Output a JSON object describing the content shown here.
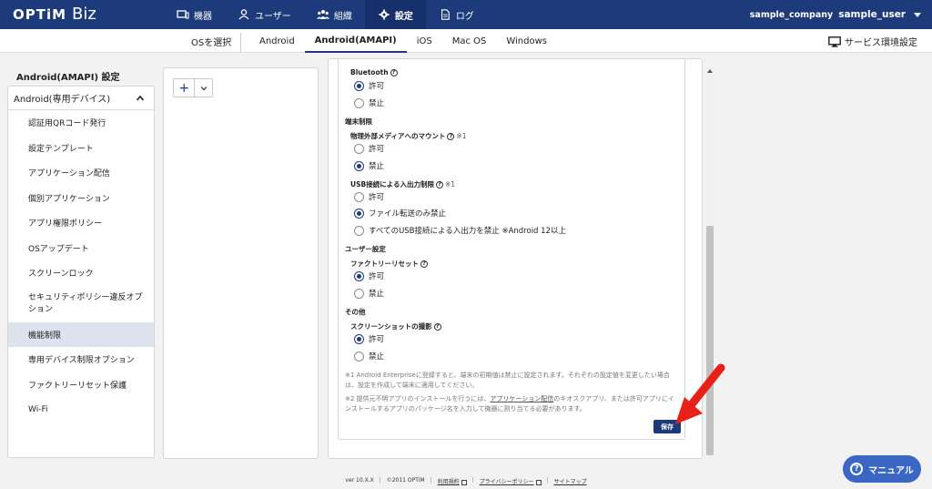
{
  "header": {
    "logo_main": "OPTiM",
    "logo_sub": "Biz",
    "nav": [
      {
        "label": "機器",
        "icon": "device-icon"
      },
      {
        "label": "ユーザー",
        "icon": "user-icon"
      },
      {
        "label": "組織",
        "icon": "group-icon"
      },
      {
        "label": "設定",
        "icon": "gear-icon"
      },
      {
        "label": "ログ",
        "icon": "log-icon"
      }
    ],
    "active_nav": "設定",
    "company": "sample_company",
    "username": "sample_user"
  },
  "subnav": {
    "os_select": "OSを選択",
    "tabs": [
      "Android",
      "Android(AMAPI)",
      "iOS",
      "Mac OS",
      "Windows"
    ],
    "active_tab": "Android(AMAPI)",
    "service_env": "サービス環境設定"
  },
  "sidebar": {
    "title": "Android(AMAPI) 設定",
    "group": "Android(専用デバイス)",
    "items": [
      "認証用QRコード発行",
      "設定テンプレート",
      "アプリケーション配信",
      "個別アプリケーション",
      "アプリ権限ポリシー",
      "OSアップデート",
      "スクリーンロック",
      "セキュリティポリシー違反オプション",
      "機能制限",
      "専用デバイス制限オプション",
      "ファクトリーリセット保護",
      "Wi-Fi"
    ],
    "active_item": "機能制限"
  },
  "middle": {
    "add_label": "+"
  },
  "settings": {
    "bluetooth_label": "Bluetooth",
    "allow": "許可",
    "deny": "禁止",
    "device_restriction": "端末制限",
    "external_media_label": "物理外部メディアへのマウント",
    "note1": "※1",
    "usb_label": "USB接続による入出力制限",
    "usb_file_only": "ファイル転送のみ禁止",
    "usb_all": "すべてのUSB接続による入出力を禁止 ※Android 12以上",
    "user_settings": "ユーザー設定",
    "factory_reset_label": "ファクトリーリセット",
    "other": "その他",
    "screenshot_label": "スクリーンショットの撮影",
    "note_text_1": "※1 Android Enterpriseに登録すると、端末の初期値は禁止に設定されます。それぞれの設定値を変更したい場合は、設定を作成して端末に適用してください。",
    "note_text_2a": "※2 提供元不明アプリのインストールを行うには、",
    "note_text_2_link": "アプリケーション配信",
    "note_text_2b": "のキオスクアプリ、または許可アプリにインストールするアプリのパッケージ名を入力して機器に割り当てる必要があります。",
    "save_label": "保存",
    "values": {
      "bluetooth": "許可",
      "external_media": "禁止",
      "usb": "ファイル転送のみ禁止",
      "factory_reset": "許可",
      "screenshot": "許可"
    }
  },
  "footer": {
    "version": "ver 10.X.X",
    "copyright": "©2011 OPTiM",
    "terms": "利用規約",
    "privacy": "プライバシーポリシー",
    "sitemap": "サイトマップ"
  },
  "manual": {
    "label": "マニュアル"
  },
  "colors": {
    "brand": "#1d3a7a",
    "manual": "#3a67c4",
    "arrow": "#e8201a"
  }
}
